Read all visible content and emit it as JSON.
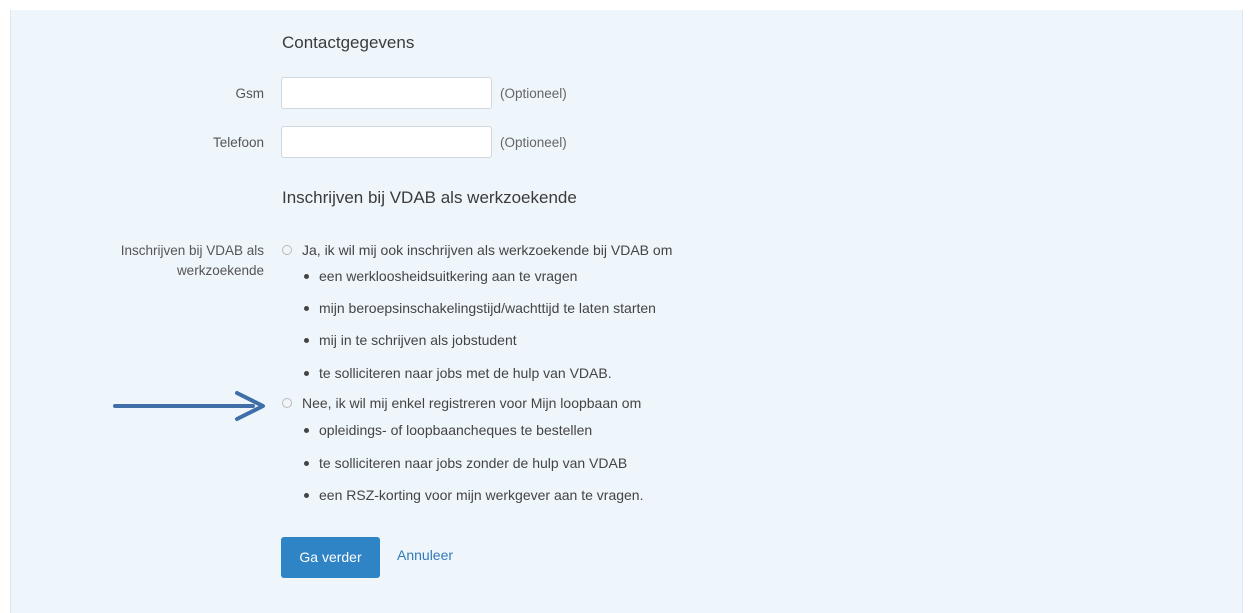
{
  "contact": {
    "title": "Contactgegevens",
    "gsm": {
      "label": "Gsm",
      "value": "",
      "hint": "(Optioneel)"
    },
    "telefoon": {
      "label": "Telefoon",
      "value": "",
      "hint": "(Optioneel)"
    }
  },
  "registration": {
    "title": "Inschrijven bij VDAB als werkzoekende",
    "label_line1": "Inschrijven bij VDAB als",
    "label_line2": "werkzoekende",
    "options": [
      {
        "label": "Ja, ik wil mij ook inschrijven als werkzoekende bij VDAB om",
        "selected": false,
        "bullets": [
          "een werkloosheidsuitkering aan te vragen",
          "mijn beroepsinschakelingstijd/wachttijd te laten starten",
          "mij in te schrijven als jobstudent",
          "te solliciteren naar jobs met de hulp van VDAB."
        ]
      },
      {
        "label": "Nee, ik wil mij enkel registreren voor Mijn loopbaan om",
        "selected": false,
        "bullets": [
          "opleidings- of loopbaancheques te bestellen",
          "te solliciteren naar jobs zonder de hulp van VDAB",
          "een RSZ-korting voor mijn werkgever aan te vragen."
        ]
      }
    ]
  },
  "actions": {
    "continue_label": "Ga verder",
    "cancel_label": "Annuleer"
  },
  "colors": {
    "panel_background": "#eef5fb",
    "primary_button": "#2e84c5",
    "link": "#3479b7",
    "annotation_arrow": "#3f6ea8"
  },
  "annotation": {
    "icon": "arrow-right-icon"
  }
}
